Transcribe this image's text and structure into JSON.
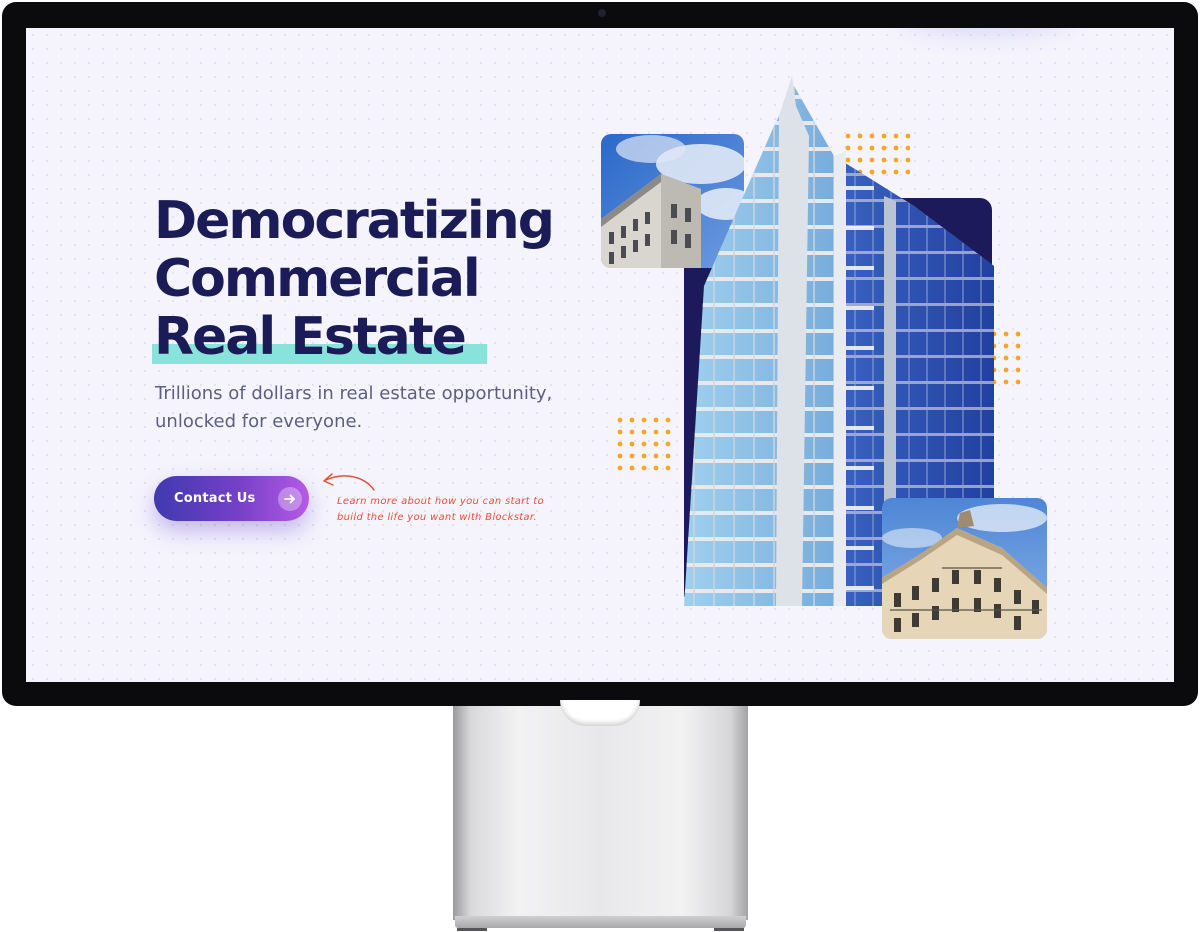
{
  "hero": {
    "title_line1": "Democratizing",
    "title_line2": "Commercial",
    "title_line3": "Real Estate",
    "subtitle_line1": "Trillions of dollars in real estate opportunity,",
    "subtitle_line2": "unlocked for everyone.",
    "cta_label": "Contact Us",
    "note_line1": "Learn more about how you can start to",
    "note_line2": "build the life you want with Blockstar."
  },
  "colors": {
    "title": "#1a1b57",
    "highlight": "#88e3da",
    "subtitle": "#5c5f82",
    "cta_gradient_start": "#3f3ab0",
    "cta_gradient_end": "#b65ae6",
    "note": "#e4513a",
    "dots_accent": "#f5a623",
    "navy_panel": "#1c1a5a"
  },
  "icons": {
    "cta_icon": "arrow-right-icon",
    "note_pointer": "curved-arrow-icon",
    "camera": "camera-dot"
  },
  "images": [
    {
      "name": "classic-building-photo",
      "subject": "classic building against cloudy sky"
    },
    {
      "name": "glass-tower-photo",
      "subject": "glass high-rise tower with balconies"
    },
    {
      "name": "parisian-building-photo",
      "subject": "ornate corner building under blue sky"
    }
  ]
}
